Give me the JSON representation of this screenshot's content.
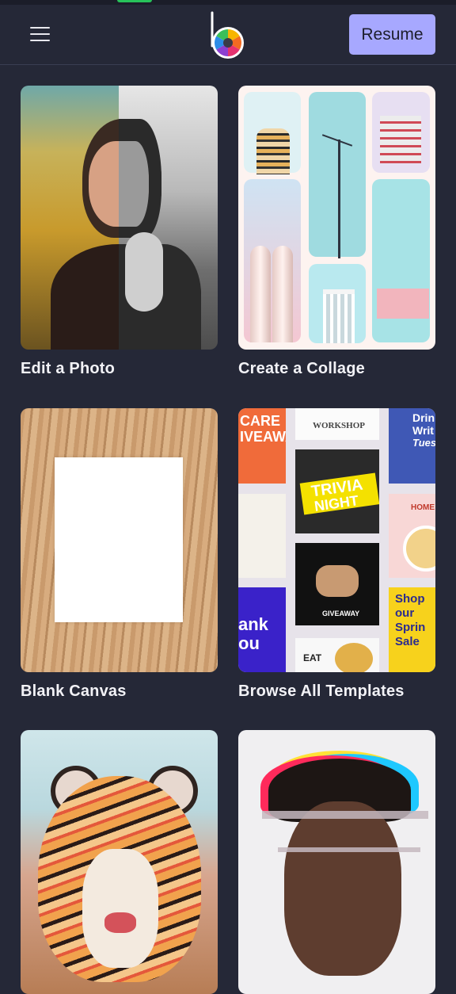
{
  "header": {
    "menu_icon": "hamburger-menu-icon",
    "logo_icon": "color-wheel-logo-icon",
    "resume_label": "Resume"
  },
  "cards": [
    {
      "label": "Edit a Photo"
    },
    {
      "label": "Create a Collage"
    },
    {
      "label": "Blank Canvas"
    },
    {
      "label": "Browse All Templates"
    },
    {
      "label": ""
    },
    {
      "label": ""
    }
  ],
  "templates_art": {
    "care": "CARE",
    "giveaway_top": "IVEAWAY",
    "workshop": "WORKSHOP",
    "trivia": "TRIVIA",
    "night": "NIGHT",
    "drink": "Drin",
    "write": "Writ",
    "tues": "Tues",
    "thank": "ank",
    "you": "ou",
    "giveaway": "GIVEAWAY",
    "eat": "EAT",
    "shop": "Shop",
    "our": "our",
    "spring": "Sprin",
    "sale": "Sale",
    "homemade": "HOME"
  },
  "colors": {
    "background": "#252837",
    "accent": "#a7a8ff",
    "text": "#f2f2f6"
  }
}
